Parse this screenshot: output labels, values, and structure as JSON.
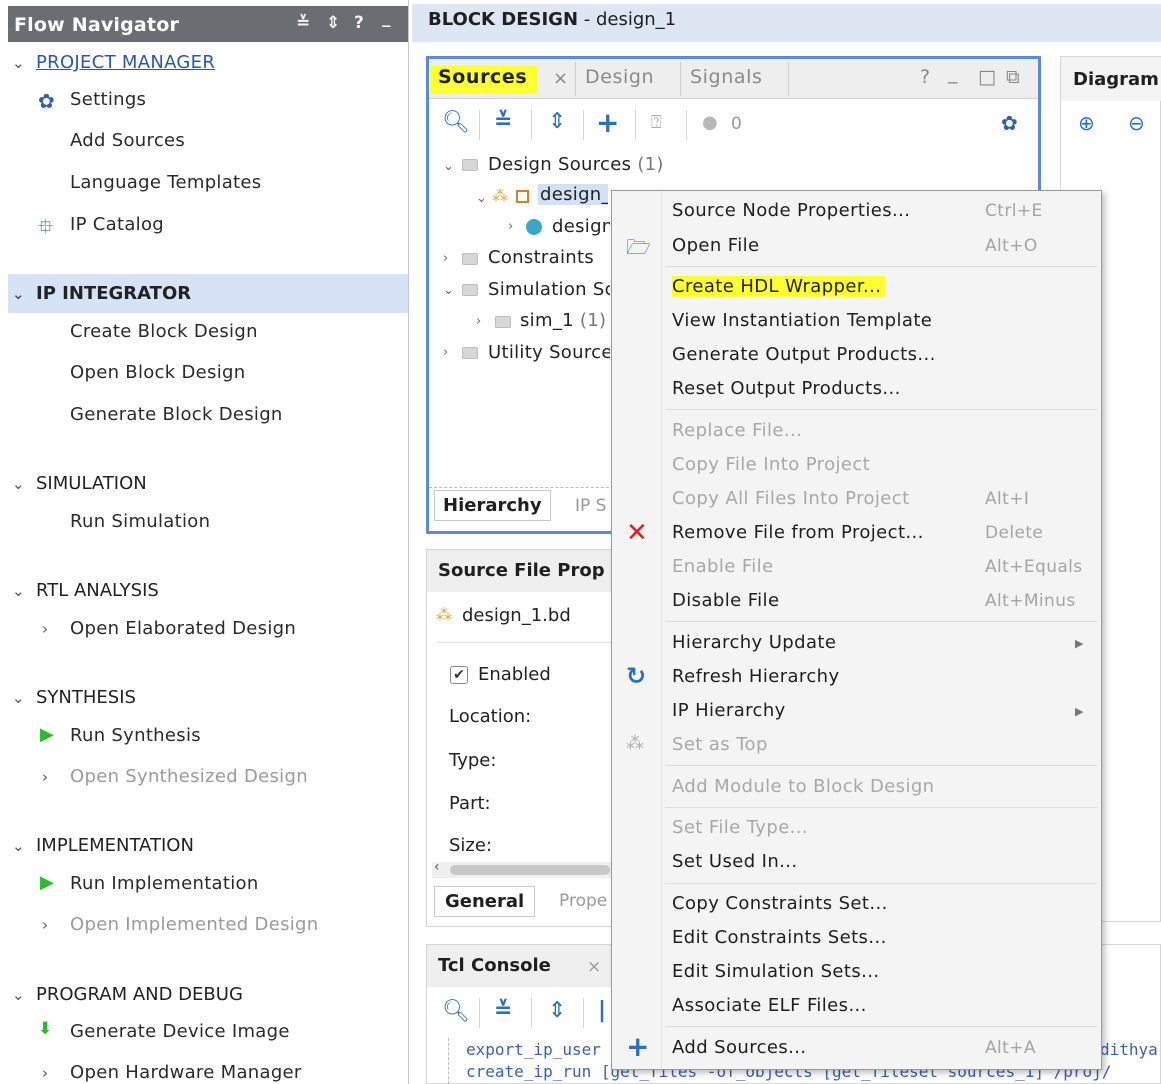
{
  "flow_navigator": {
    "title": "Flow Navigator",
    "header_icons": [
      "≚",
      "⇕",
      "?",
      "_"
    ],
    "sections": {
      "project_manager": {
        "label": "PROJECT MANAGER",
        "items": [
          "Settings",
          "Add Sources",
          "Language Templates",
          "IP Catalog"
        ]
      },
      "ip_integrator": {
        "label": "IP INTEGRATOR",
        "items": [
          "Create Block Design",
          "Open Block Design",
          "Generate Block Design"
        ]
      },
      "simulation": {
        "label": "SIMULATION",
        "items": [
          "Run Simulation"
        ]
      },
      "rtl_analysis": {
        "label": "RTL ANALYSIS",
        "items": [
          "Open Elaborated Design"
        ]
      },
      "synthesis": {
        "label": "SYNTHESIS",
        "items": [
          "Run Synthesis",
          "Open Synthesized Design"
        ]
      },
      "implementation": {
        "label": "IMPLEMENTATION",
        "items": [
          "Run Implementation",
          "Open Implemented Design"
        ]
      },
      "program_debug": {
        "label": "PROGRAM AND DEBUG",
        "items": [
          "Generate Device Image",
          "Open Hardware Manager"
        ]
      }
    }
  },
  "main": {
    "title_bold": "BLOCK DESIGN",
    "title_rest": " - design_1"
  },
  "sources_panel": {
    "tabs": [
      "Sources",
      "Design",
      "Signals"
    ],
    "tab_close": "×",
    "window_controls": [
      "?",
      "_",
      "□",
      "⧉"
    ],
    "toolbar_count": "0",
    "tree": {
      "design_sources": "Design Sources",
      "design_sources_count": "(1)",
      "design_item": "design_",
      "design_child": "design",
      "constraints": "Constraints",
      "simulation_sources": "Simulation Sc",
      "sim_1": "sim_1",
      "sim_1_count": "(1)",
      "utility_sources": "Utility Source"
    },
    "bottom_tabs": [
      "Hierarchy",
      "IP S"
    ]
  },
  "source_file_properties": {
    "title": "Source File Prop",
    "file": "design_1.bd",
    "enabled_label": "Enabled",
    "fields": [
      "Location:",
      "Type:",
      "Part:",
      "Size:"
    ],
    "bottom_tabs": [
      "General",
      "Prope"
    ]
  },
  "tcl_console": {
    "title": "Tcl Console",
    "close": "×",
    "lines": [
      "export_ip_user",
      "create_ip_run [get_files -of_objects [get_fileset sources_1] /proj/"
    ],
    "right_fragment": "dithya"
  },
  "diagram_panel": {
    "title": "Diagram"
  },
  "context_menu": {
    "items": [
      {
        "label": "Source Node Properties...",
        "shortcut": "Ctrl+E",
        "disabled": false
      },
      {
        "label": "Open File",
        "shortcut": "Alt+O",
        "disabled": false
      },
      {
        "label": "Create HDL Wrapper...",
        "shortcut": "",
        "disabled": false,
        "highlighted": true
      },
      {
        "label": "View Instantiation Template",
        "shortcut": "",
        "disabled": false
      },
      {
        "label": "Generate Output Products...",
        "shortcut": "",
        "disabled": false
      },
      {
        "label": "Reset Output Products...",
        "shortcut": "",
        "disabled": false
      },
      {
        "label": "Replace File...",
        "shortcut": "",
        "disabled": true
      },
      {
        "label": "Copy File Into Project",
        "shortcut": "",
        "disabled": true
      },
      {
        "label": "Copy All Files Into Project",
        "shortcut": "Alt+I",
        "disabled": true
      },
      {
        "label": "Remove File from Project...",
        "shortcut": "Delete",
        "disabled": false
      },
      {
        "label": "Enable File",
        "shortcut": "Alt+Equals",
        "disabled": true
      },
      {
        "label": "Disable File",
        "shortcut": "Alt+Minus",
        "disabled": false
      },
      {
        "label": "Hierarchy Update",
        "shortcut": "",
        "disabled": false,
        "submenu": true
      },
      {
        "label": "Refresh Hierarchy",
        "shortcut": "",
        "disabled": false
      },
      {
        "label": "IP Hierarchy",
        "shortcut": "",
        "disabled": false,
        "submenu": true
      },
      {
        "label": "Set as Top",
        "shortcut": "",
        "disabled": true
      },
      {
        "label": "Add Module to Block Design",
        "shortcut": "",
        "disabled": true
      },
      {
        "label": "Set File Type...",
        "shortcut": "",
        "disabled": true
      },
      {
        "label": "Set Used In...",
        "shortcut": "",
        "disabled": false
      },
      {
        "label": "Copy Constraints Set...",
        "shortcut": "",
        "disabled": false
      },
      {
        "label": "Edit Constraints Sets...",
        "shortcut": "",
        "disabled": false
      },
      {
        "label": "Edit Simulation Sets...",
        "shortcut": "",
        "disabled": false
      },
      {
        "label": "Associate ELF Files...",
        "shortcut": "",
        "disabled": false
      },
      {
        "label": "Add Sources...",
        "shortcut": "Alt+A",
        "disabled": false
      }
    ]
  },
  "colors": {
    "accent_blue": "#2f6fb8",
    "highlight_yellow": "#ffff33",
    "selection_band": "#d6e3f7",
    "header_gray": "#6a6d72",
    "remove_red": "#e02020",
    "run_green": "#2eb82e"
  }
}
